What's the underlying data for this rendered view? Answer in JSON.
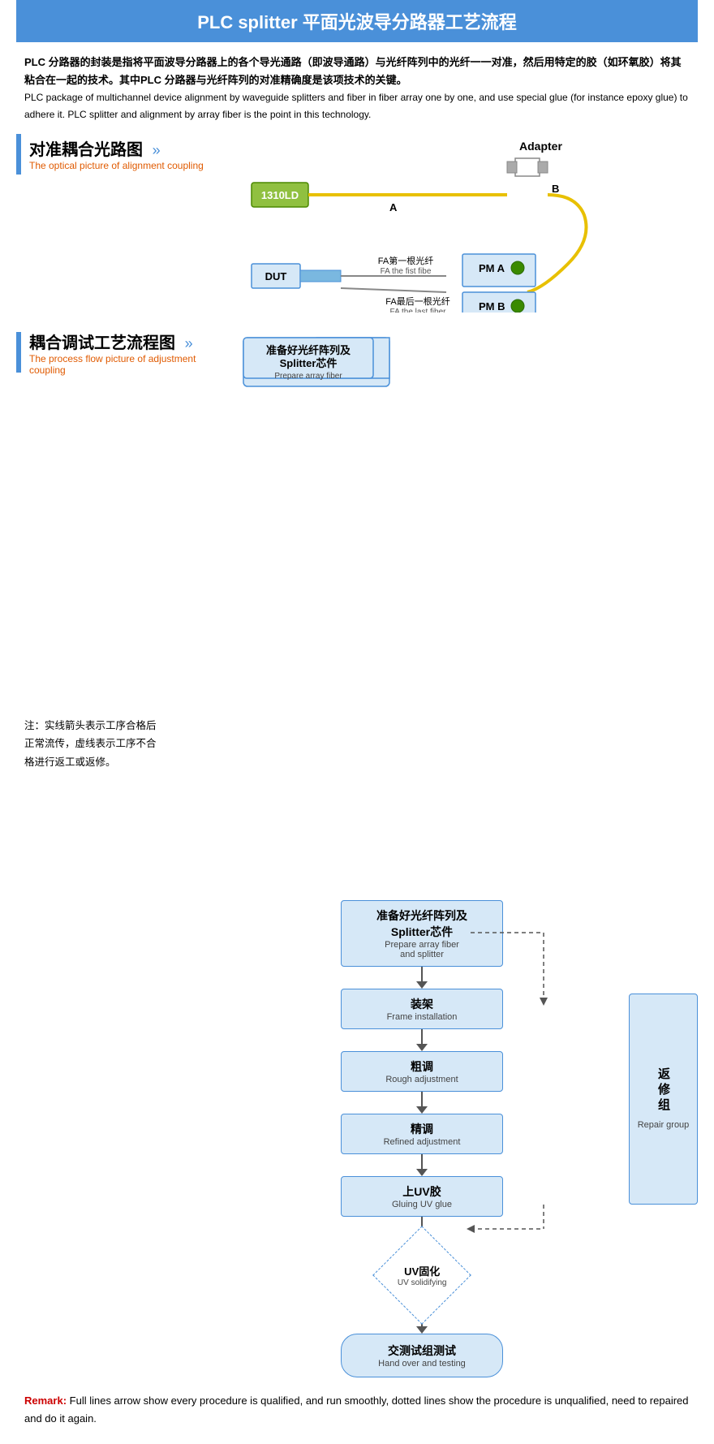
{
  "title": "PLC splitter 平面光波导分路器工艺流程",
  "intro": {
    "cn": "PLC 分路器的封装是指将平面波导分路器上的各个导光通路（即波导通路）与光纤阵列中的光纤一一对准，然后用特定的胶（如环氧胶）将其粘合在一起的技术。其中PLC 分路器与光纤阵列的对准精确度是该项技术的关键。",
    "en": "PLC package of multichannel device alignment by waveguide splitters and fiber in fiber array one by one, and use special glue (for instance epoxy glue) to adhere it. PLC splitter and alignment by array fiber is the point in this technology."
  },
  "section1": {
    "title_cn": "对准耦合光路图",
    "arrows": "»",
    "title_en": "The optical picture of alignment coupling"
  },
  "section2": {
    "title_cn": "耦合调试工艺流程图",
    "arrows": "»",
    "title_en": "The process flow picture of adjustment coupling"
  },
  "diagram": {
    "adapter": "Adapter",
    "laser": "1310LD",
    "point_a": "A",
    "point_b": "B",
    "dut": "DUT",
    "fa_first_cn": "FA第一根光纤",
    "fa_first_en": "FA the fist fibe",
    "fa_last_cn": "FA最后一根光纤",
    "fa_last_en": "FA the last fiber",
    "pm_a": "PM  A",
    "pm_b": "PM  B"
  },
  "flowchart": {
    "step1_cn": "准备好光纤阵列及\nSplitter芯件",
    "step1_en": "Prepare array fiber\nand splitter",
    "step2_cn": "装架",
    "step2_en": "Frame installation",
    "step3_cn": "粗调",
    "step3_en": "Rough adjustment",
    "step4_cn": "精调",
    "step4_en": "Refined adjustment",
    "step5_cn": "上UV胶",
    "step5_en": "Gluing UV glue",
    "step6_cn": "UV固化",
    "step6_en": "UV solidifying",
    "step7_cn": "交测试组测试",
    "step7_en": "Hand over and testing",
    "repair_cn": "返修组",
    "repair_en": "Repair group"
  },
  "remark": {
    "cn_line1": "注：实线箭头表示工序合格后",
    "cn_line2": "正常流传，虚线表示工序不合",
    "cn_line3": "格进行返工或返修。",
    "en_bold": "Remark:",
    "en_text": " Full lines arrow show every procedure is qualified, and run smoothly, dotted lines show the procedure  is unqualified, need to repaired and do it again."
  }
}
